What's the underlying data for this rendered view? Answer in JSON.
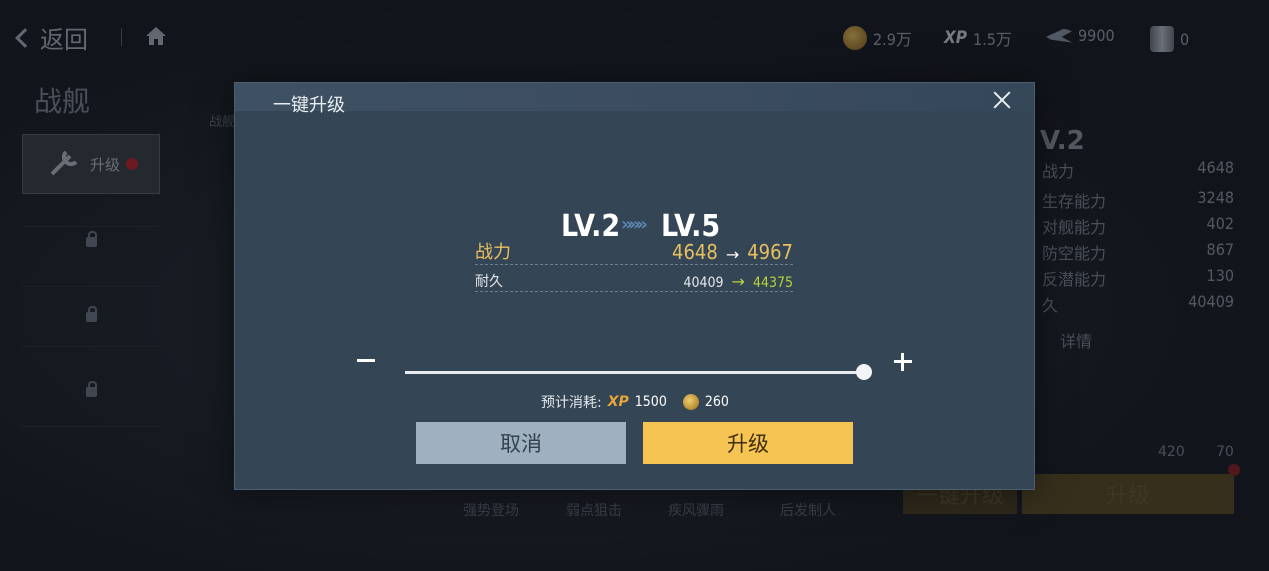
{
  "topbar": {
    "back_label": "返回",
    "resources": [
      {
        "icon": "gold-coin-icon",
        "value": "2.9万"
      },
      {
        "icon": "xp-icon",
        "label": "XP",
        "value": "1.5万"
      },
      {
        "icon": "aircraft-part-icon",
        "value": "9900"
      },
      {
        "icon": "steel-cylinder-icon",
        "value": "0"
      }
    ]
  },
  "left": {
    "title": "战舰",
    "upgrade_tile_label": "升级",
    "side_tag": "战舰"
  },
  "right_stats": {
    "level": "V.2",
    "rows": [
      {
        "label": "战力",
        "value": "4648"
      },
      {
        "label": "生存能力",
        "value": "3248"
      },
      {
        "label": "对舰能力",
        "value": "402"
      },
      {
        "label": "防空能力",
        "value": "867"
      },
      {
        "label": "反潜能力",
        "value": "130"
      },
      {
        "label": "久",
        "value": "40409"
      }
    ],
    "details_label": "详情",
    "cost_xp": "420",
    "cost_coin": "70"
  },
  "background_buttons": {
    "one_key": "一键升级",
    "upgrade": "升级"
  },
  "bottom_tags": [
    "强势登场",
    "弱点狙击",
    "疾风骤雨",
    "后发制人"
  ],
  "modal": {
    "title": "一键升级",
    "level_from": "LV.2",
    "level_to": "LV.5",
    "level_arrows": "»»»",
    "power": {
      "label": "战力",
      "from": "4648",
      "arrow": "→",
      "to": "4967"
    },
    "durability": {
      "label": "耐久",
      "from": "40409",
      "arrow": "→",
      "to": "44375"
    },
    "slider": {
      "value_fraction": 1.0
    },
    "cost": {
      "label": "预计消耗:",
      "xp_label": "XP",
      "xp": "1500",
      "coin": "260"
    },
    "cancel_label": "取消",
    "upgrade_label": "升级"
  }
}
